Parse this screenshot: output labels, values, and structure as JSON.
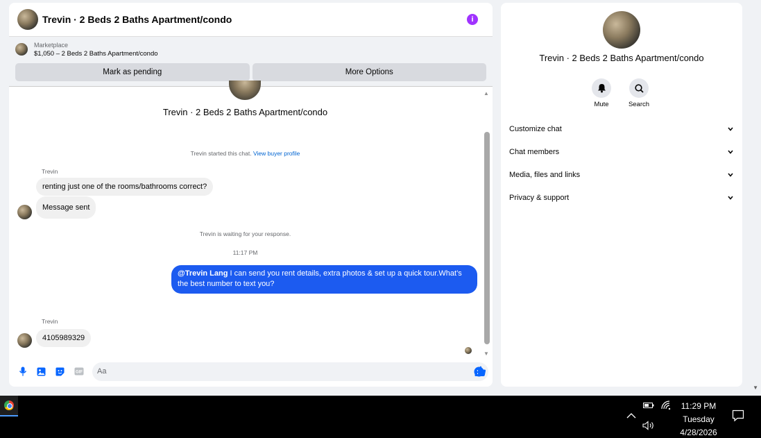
{
  "chat": {
    "header_title": "Trevin · 2 Beds 2 Baths Apartment/condo",
    "info_icon": "info-icon",
    "marketplace": {
      "label": "Marketplace",
      "listing": "$1,050 – 2 Beds 2 Baths Apartment/condo",
      "pending_button": "Mark as pending",
      "options_button": "More Options"
    },
    "center_title": "Trevin · 2 Beds 2 Baths Apartment/condo",
    "started_text": "Trevin started this chat.",
    "view_profile_link": "View buyer profile",
    "messages": [
      {
        "sender": "Trevin",
        "text": "renting just one of the rooms/bathrooms correct?"
      },
      {
        "sender": "",
        "text": "Message sent"
      }
    ],
    "waiting_text": "Trevin is waiting for your response.",
    "timestamp": "11:17 PM",
    "outgoing": {
      "mention": "@Trevin Lang",
      "text": " I can send you rent details, extra photos & set up a quick tour.What’s the best number to text you?"
    },
    "reply": {
      "sender": "Trevin",
      "text": "4105989329"
    },
    "composer": {
      "placeholder": "Aa",
      "icons": [
        "microphone-icon",
        "image-icon",
        "sticker-icon",
        "gif-icon",
        "emoji-icon",
        "thumbs-up-icon"
      ],
      "gif_label": "GIF"
    },
    "accent_color": "#1c5bf0"
  },
  "info_panel": {
    "title": "Trevin · 2 Beds 2 Baths Apartment/condo",
    "actions": [
      {
        "label": "Mute",
        "icon": "bell-icon"
      },
      {
        "label": "Search",
        "icon": "search-icon"
      }
    ],
    "sections": [
      {
        "label": "Customize chat"
      },
      {
        "label": "Chat members"
      },
      {
        "label": "Media, files and links"
      },
      {
        "label": "Privacy & support"
      }
    ]
  },
  "taskbar": {
    "time": "11:29 PM",
    "day": "Tuesday",
    "date": "4/28/2026"
  }
}
